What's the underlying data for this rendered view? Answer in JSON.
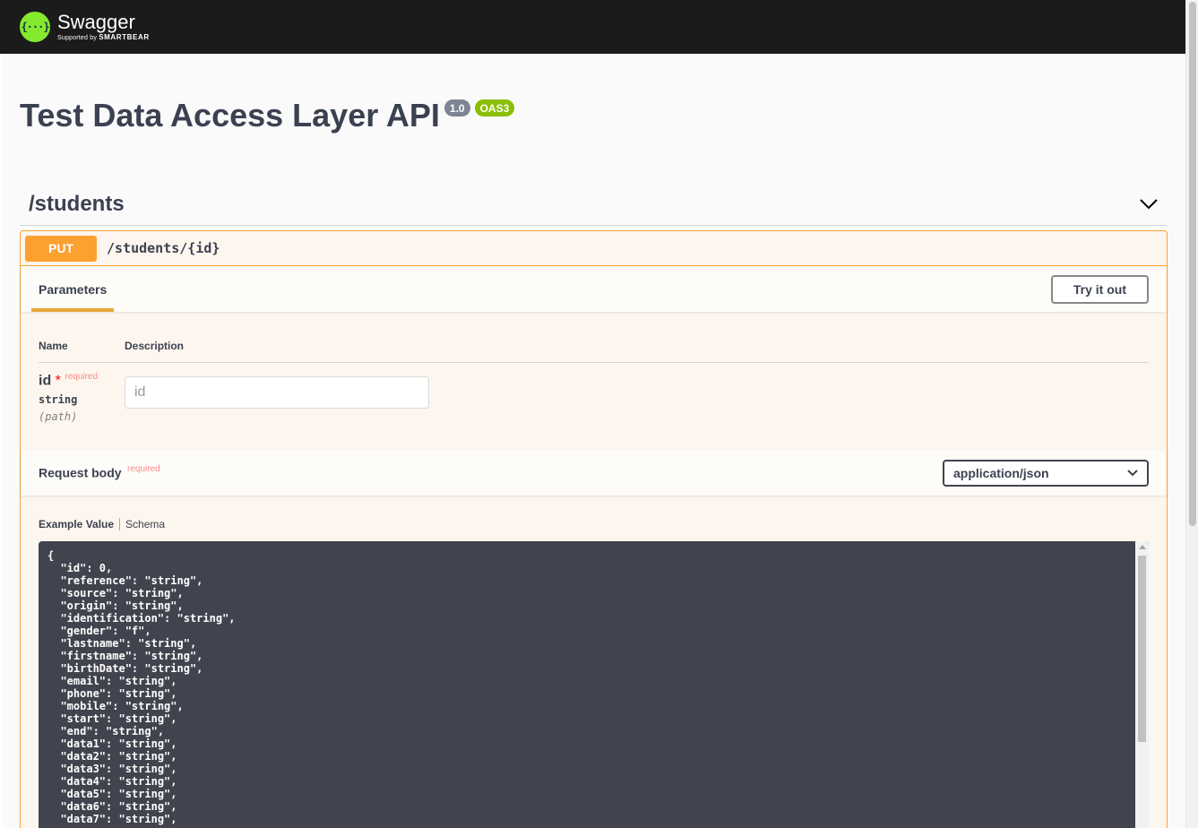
{
  "topbar": {
    "logo_glyph": "{···}",
    "logo_name": "Swagger",
    "logo_sub_prefix": "Supported by",
    "logo_sub_brand": "SMARTBEAR"
  },
  "info": {
    "title": "Test Data Access Layer API",
    "version": "1.0",
    "oas": "OAS3"
  },
  "tag": {
    "name": "/students",
    "icon": "chevron-down-icon"
  },
  "operation": {
    "method": "PUT",
    "path": "/students/{id}",
    "method_color": "#fca130",
    "parameters_tab": "Parameters",
    "try_button": "Try it out",
    "columns": {
      "name": "Name",
      "description": "Description"
    },
    "param": {
      "name": "id",
      "star": "*",
      "required": "required",
      "type": "string",
      "in": "(path)",
      "placeholder": "id"
    },
    "request_body": {
      "title": "Request body",
      "required": "required",
      "content_type": "application/json"
    },
    "example": {
      "tab_value": "Example Value",
      "tab_schema": "Schema",
      "code": "{\n  \"id\": 0,\n  \"reference\": \"string\",\n  \"source\": \"string\",\n  \"origin\": \"string\",\n  \"identification\": \"string\",\n  \"gender\": \"f\",\n  \"lastname\": \"string\",\n  \"firstname\": \"string\",\n  \"birthDate\": \"string\",\n  \"email\": \"string\",\n  \"phone\": \"string\",\n  \"mobile\": \"string\",\n  \"start\": \"string\",\n  \"end\": \"string\",\n  \"data1\": \"string\",\n  \"data2\": \"string\",\n  \"data3\": \"string\",\n  \"data4\": \"string\",\n  \"data5\": \"string\",\n  \"data6\": \"string\",\n  \"data7\": \"string\","
    }
  }
}
